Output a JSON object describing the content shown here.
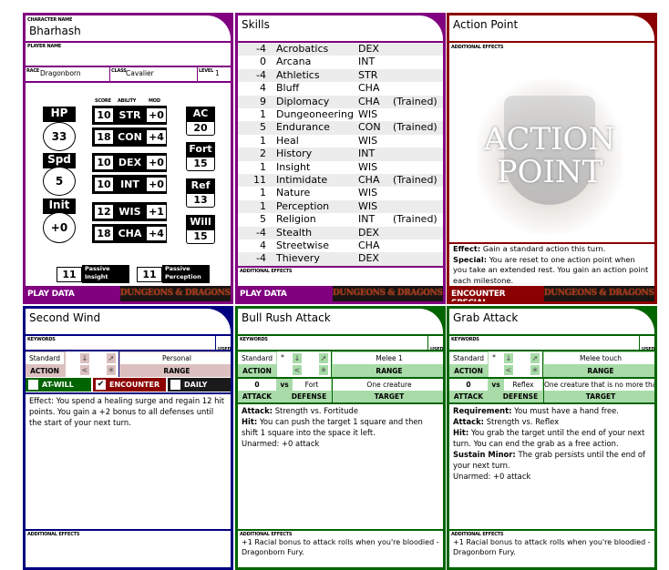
{
  "colors": {
    "play": "#800080",
    "encounter_special": "#8b0000",
    "utility": "#000080",
    "attack": "#006400",
    "attack_light": "#a9dba9",
    "utility_light": "#dcc0c0"
  },
  "char": {
    "name_label": "CHARACTER NAME",
    "name": "Bharhash",
    "player_label": "PLAYER NAME",
    "player": "",
    "race_label": "RACE",
    "race": "Dragonborn",
    "class_label": "CLASS",
    "class": "Cavalier",
    "level_label": "LEVEL",
    "level": "1",
    "headers": {
      "score": "SCORE",
      "ability": "ABILITY",
      "mod": "MOD"
    },
    "abilities": [
      {
        "score": "10",
        "name": "STR",
        "mod": "+0"
      },
      {
        "score": "18",
        "name": "CON",
        "mod": "+4"
      },
      {
        "score": "10",
        "name": "DEX",
        "mod": "+0"
      },
      {
        "score": "10",
        "name": "INT",
        "mod": "+0"
      },
      {
        "score": "12",
        "name": "WIS",
        "mod": "+1"
      },
      {
        "score": "18",
        "name": "CHA",
        "mod": "+4"
      }
    ],
    "hp": {
      "label": "HP",
      "value": "33"
    },
    "speed": {
      "label": "Spd",
      "value": "5"
    },
    "init": {
      "label": "Init",
      "value": "+0"
    },
    "defenses": [
      {
        "label": "AC",
        "value": "20"
      },
      {
        "label": "Fort",
        "value": "15"
      },
      {
        "label": "Ref",
        "value": "13"
      },
      {
        "label": "Will",
        "value": "15"
      }
    ],
    "passive_insight": {
      "value": "11",
      "label1": "Passive",
      "label2": "Insight"
    },
    "passive_perception": {
      "value": "11",
      "label1": "Passive",
      "label2": "Perception"
    },
    "footer": "PLAY DATA",
    "logo": "DUNGEONS & DRAGONS"
  },
  "skills": {
    "title": "Skills",
    "additional_label": "ADDITIONAL EFFECTS",
    "footer": "PLAY DATA",
    "logo": "DUNGEONS & DRAGONS",
    "rows": [
      [
        "-4",
        "Acrobatics",
        "DEX",
        ""
      ],
      [
        "0",
        "Arcana",
        "INT",
        ""
      ],
      [
        "-4",
        "Athletics",
        "STR",
        ""
      ],
      [
        "4",
        "Bluff",
        "CHA",
        ""
      ],
      [
        "9",
        "Diplomacy",
        "CHA",
        "(Trained)"
      ],
      [
        "1",
        "Dungeoneering",
        "WIS",
        ""
      ],
      [
        "5",
        "Endurance",
        "CON",
        "(Trained)"
      ],
      [
        "1",
        "Heal",
        "WIS",
        ""
      ],
      [
        "2",
        "History",
        "INT",
        ""
      ],
      [
        "1",
        "Insight",
        "WIS",
        ""
      ],
      [
        "11",
        "Intimidate",
        "CHA",
        "(Trained)"
      ],
      [
        "1",
        "Nature",
        "WIS",
        ""
      ],
      [
        "1",
        "Perception",
        "WIS",
        ""
      ],
      [
        "5",
        "Religion",
        "INT",
        "(Trained)"
      ],
      [
        "-4",
        "Stealth",
        "DEX",
        ""
      ],
      [
        "4",
        "Streetwise",
        "CHA",
        ""
      ],
      [
        "-4",
        "Thievery",
        "DEX",
        ""
      ]
    ]
  },
  "action_point": {
    "title": "Action Point",
    "additional_label": "ADDITIONAL EFFECTS",
    "art_line1": "ACTION",
    "art_line2": "POINT",
    "effect_label": "Effect:",
    "effect": " Gain a standard action this turn.",
    "special_label": "Special:",
    "special": " You are reset to one action point when you take an extended rest. You gain an action point each milestone.",
    "footer": "ENCOUNTER SPECIAL",
    "logo": "DUNGEONS & DRAGONS"
  },
  "second_wind": {
    "title": "Second Wind",
    "keywords_label": "KEYWORDS",
    "used_label": "USED",
    "action": "Standard",
    "action_label": "ACTION",
    "range": "Personal",
    "range_label": "RANGE",
    "at_will": "AT-WILL",
    "encounter": "ENCOUNTER",
    "daily": "DAILY",
    "encounter_checked": true,
    "text": "Effect: You spend a healing surge and regain 12 hit points. You gain a +2 bonus to all defenses until the start of your next turn.",
    "additional_label": "ADDITIONAL EFFECTS"
  },
  "powers": [
    {
      "title": "Bull Rush Attack",
      "keywords_label": "KEYWORDS",
      "used_label": "USED",
      "action": "Standard",
      "action_label": "ACTION",
      "star": "*",
      "range": "Melee 1",
      "range_label": "RANGE",
      "attack": "0",
      "vs": "vs",
      "defense": "Fort",
      "attack_label": "ATTACK",
      "defense_label": "DEFENSE",
      "target": "One creature",
      "target_label": "TARGET",
      "lines": [
        {
          "b": "Attack:",
          "t": " Strength vs. Fortitude"
        },
        {
          "b": "Hit:",
          "t": " You can push the target 1 square and then shift 1 square into the space it left."
        },
        {
          "b": "",
          "t": " "
        },
        {
          "b": "",
          "t": "Unarmed: +0 attack"
        }
      ],
      "additional_label": "ADDITIONAL EFFECTS",
      "additional": "+1 Racial bonus to attack rolls when you're bloodied - Dragonborn Fury."
    },
    {
      "title": "Grab Attack",
      "keywords_label": "KEYWORDS",
      "used_label": "USED",
      "action": "Standard",
      "action_label": "ACTION",
      "star": "*",
      "range": "Melee touch",
      "range_label": "RANGE",
      "attack": "0",
      "vs": "vs",
      "defense": "Reflex",
      "attack_label": "ATTACK",
      "defense_label": "DEFENSE",
      "target": "One creature that is no more than",
      "target_label": "TARGET",
      "lines": [
        {
          "b": "Requirement:",
          "t": " You must have a hand free."
        },
        {
          "b": "Attack:",
          "t": " Strength vs. Reflex"
        },
        {
          "b": "Hit:",
          "t": " You grab the target until the end of your next turn. You can end the grab as a free action."
        },
        {
          "b": "Sustain Minor:",
          "t": " The grab persists until the end of your next turn."
        },
        {
          "b": "",
          "t": " "
        },
        {
          "b": "",
          "t": "Unarmed: +0 attack"
        }
      ],
      "additional_label": "ADDITIONAL EFFECTS",
      "additional": "+1 Racial bonus to attack rolls when you're bloodied - Dragonborn Fury."
    }
  ]
}
